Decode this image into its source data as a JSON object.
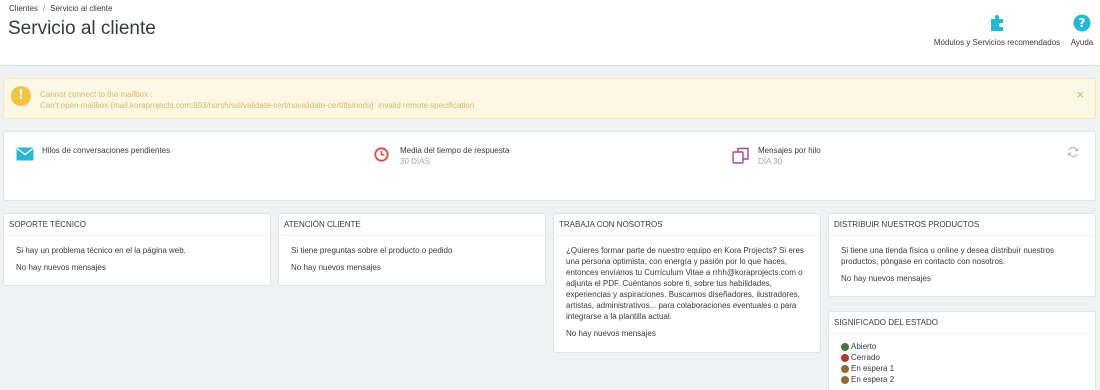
{
  "breadcrumb": {
    "parent": "Clientes",
    "separator": "/",
    "current": "Servicio al cliente"
  },
  "page_title": "Servicio al cliente",
  "toolbar": {
    "modules_label": "Módulos y Servicios recomendados",
    "help_label": "Ayuda",
    "modules_icon": "puzzle-icon",
    "help_icon": "question-circle-icon",
    "icon_color": "#25b9d7"
  },
  "alert": {
    "line1": "Cannot connect to the mailbox :",
    "line2": "Can't open mailbox {mail.koraprojects.com:993/norsh/ssl/validate-cert/novalidate-cert/tls/nods}: invalid remote specification",
    "close": "×",
    "icon_glyph": "!"
  },
  "kpis": {
    "pending": {
      "label": "Hilos de conversaciones pendientes",
      "sub": ""
    },
    "response": {
      "label": "Media del tiempo de respuesta",
      "sub": "30 DÍAS"
    },
    "messages": {
      "label": "Mensajes por hilo",
      "sub": "DÍA 30"
    }
  },
  "panels": {
    "support": {
      "title": "SOPORTE TÉCNICO",
      "text": "Si hay un problema técnico en el la página web.",
      "empty": "No hay nuevos mensajes"
    },
    "attention": {
      "title": "ATENCIÓN CLIENTE",
      "text": "Si tiene preguntas sobre el producto o pedido",
      "empty": "No hay nuevos mensajes"
    },
    "jobs": {
      "title": "TRABAJA CON NOSOTROS",
      "text": "¿Quieres formar parte de nuestro equipo en Kora Projects? Si eres una persona optimista, con energía y pasión por lo que haces, entonces envíanos tu Currículum Vitae a rrhh@koraprojects.com o adjunta el PDF. Cuéntanos sobre ti, sobre tus habilidades, experiencias y aspiraciones. Buscamos diseñadores, ilustradores, artistas, administrativos... para colaboraciones eventuales o para integrarse a la plantilla actual.",
      "empty": "No hay nuevos mensajes"
    },
    "distribute": {
      "title": "DISTRIBUIR NUESTROS PRODUCTOS",
      "text": "Si tiene una tienda física u online y desea distribuir nuestros productos, póngase en contacto con nosotros.",
      "empty": "No hay nuevos mensajes"
    },
    "status": {
      "title": "SIGNIFICADO DEL ESTADO",
      "items": [
        {
          "label": "Abierto",
          "color": "#3a7d3a"
        },
        {
          "label": "Cerrado",
          "color": "#b03a2e"
        },
        {
          "label": "En espera 1",
          "color": "#8a6d2f"
        },
        {
          "label": "En espera 2",
          "color": "#8a6d2f"
        }
      ]
    }
  }
}
